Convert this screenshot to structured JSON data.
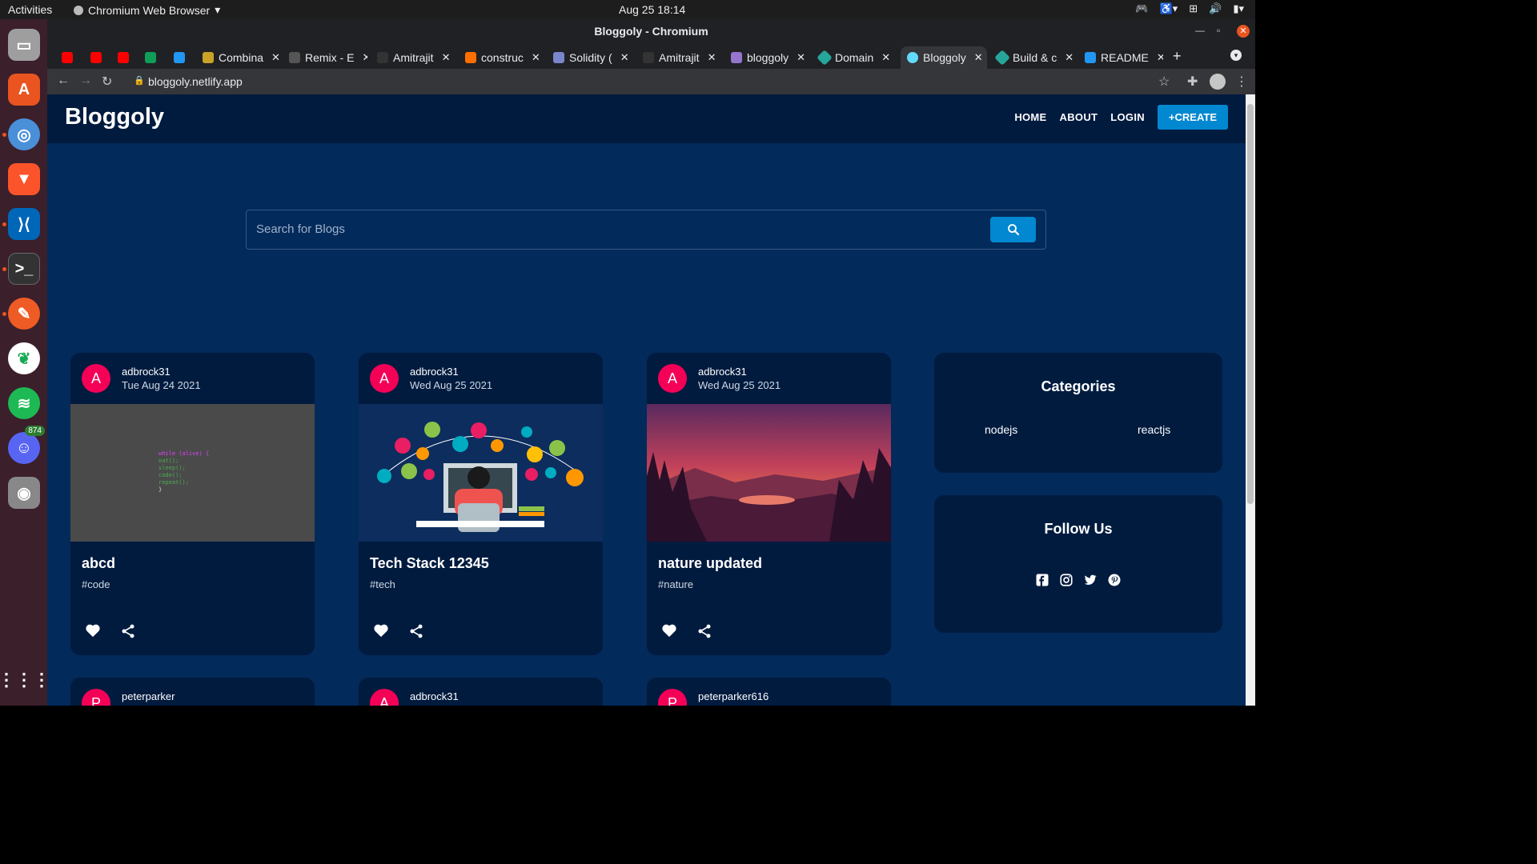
{
  "os": {
    "activities": "Activities",
    "app_name": "Chromium Web Browser",
    "clock": "Aug 25  18:14",
    "dock_badge": "874"
  },
  "browser": {
    "window_title": "Bloggoly - Chromium",
    "url": "bloggoly.netlify.app",
    "tabs": [
      {
        "label": "",
        "color": "#ff0000"
      },
      {
        "label": "",
        "color": "#ff0000"
      },
      {
        "label": "",
        "color": "#ff0000"
      },
      {
        "label": "",
        "color": "#0f9d58"
      },
      {
        "label": "",
        "color": "#2196f3"
      },
      {
        "label": "Combina",
        "color": "#c9a227"
      },
      {
        "label": "Remix - E",
        "color": "#555555"
      },
      {
        "label": "Amitrajit",
        "color": "#333333"
      },
      {
        "label": "construc",
        "color": "#ff6f00"
      },
      {
        "label": "Solidity (",
        "color": "#7986cb"
      },
      {
        "label": "Amitrajit",
        "color": "#333333"
      },
      {
        "label": "bloggoly",
        "color": "#9575cd"
      },
      {
        "label": "Domain",
        "color": "#26a69a"
      },
      {
        "label": "Bloggoly",
        "color": "#61dafb"
      },
      {
        "label": "Build & c",
        "color": "#26a69a"
      },
      {
        "label": "README",
        "color": "#2196f3"
      }
    ]
  },
  "site": {
    "brand": "Bloggoly",
    "nav": {
      "home": "HOME",
      "about": "ABOUT",
      "login": "LOGIN",
      "create": "+CREATE"
    },
    "search_placeholder": "Search for Blogs",
    "posts": [
      {
        "avatar": "A",
        "author": "adbrock31",
        "date": "Tue Aug 24 2021",
        "title": "abcd",
        "tag": "#code",
        "image": "code-snippet"
      },
      {
        "avatar": "A",
        "author": "adbrock31",
        "date": "Wed Aug 25 2021",
        "title": "Tech Stack 12345",
        "tag": "#tech",
        "image": "tech-illustration"
      },
      {
        "avatar": "A",
        "author": "adbrock31",
        "date": "Wed Aug 25 2021",
        "title": "nature updated",
        "tag": "#nature",
        "image": "sunset-landscape"
      }
    ],
    "posts_row2": [
      {
        "avatar": "P",
        "author": "peterparker"
      },
      {
        "avatar": "A",
        "author": "adbrock31"
      },
      {
        "avatar": "P",
        "author": "peterparker616"
      }
    ],
    "categories": {
      "title": "Categories",
      "items": [
        "nodejs",
        "reactjs"
      ]
    },
    "follow": {
      "title": "Follow Us",
      "icons": [
        "facebook-icon",
        "instagram-icon",
        "twitter-icon",
        "pinterest-icon"
      ]
    },
    "code_lines": [
      "while (alive) {",
      "  eat();",
      "  sleep();",
      "  code();",
      "  repeat();",
      "}"
    ],
    "colors": {
      "nav_bg": "#011b3f",
      "page_bg": "#022a5a",
      "accent": "#0288d1",
      "avatar": "#f50057"
    }
  }
}
